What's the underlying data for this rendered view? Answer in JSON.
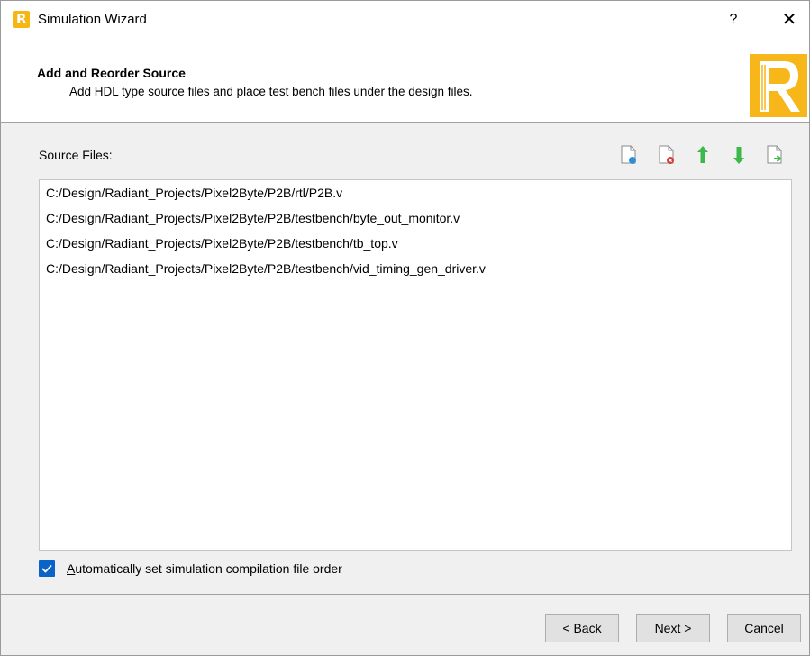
{
  "window": {
    "title": "Simulation Wizard",
    "help_label": "?",
    "close_label": "✕"
  },
  "header": {
    "title": "Add and Reorder Source",
    "subtitle": "Add HDL type source files and place test bench files under the design files."
  },
  "source_files": {
    "label": "Source Files:",
    "toolbar": [
      "add-file-icon",
      "remove-file-icon",
      "move-up-icon",
      "move-down-icon",
      "import-file-icon"
    ],
    "items": [
      "C:/Design/Radiant_Projects/Pixel2Byte/P2B/rtl/P2B.v",
      "C:/Design/Radiant_Projects/Pixel2Byte/P2B/testbench/byte_out_monitor.v",
      "C:/Design/Radiant_Projects/Pixel2Byte/P2B/testbench/tb_top.v",
      "C:/Design/Radiant_Projects/Pixel2Byte/P2B/testbench/vid_timing_gen_driver.v"
    ]
  },
  "options": {
    "auto_order_checked": true,
    "auto_order_label_prefix": "A",
    "auto_order_label_rest": "utomatically set simulation compilation file order"
  },
  "buttons": {
    "back": "< Back",
    "next": "Next >",
    "cancel": "Cancel"
  },
  "colors": {
    "accent": "#0a64c8",
    "brand": "#f7b61a",
    "arrow_green": "#3cb84a",
    "add_blue": "#2d8fd5",
    "remove_red": "#d83a3a"
  }
}
